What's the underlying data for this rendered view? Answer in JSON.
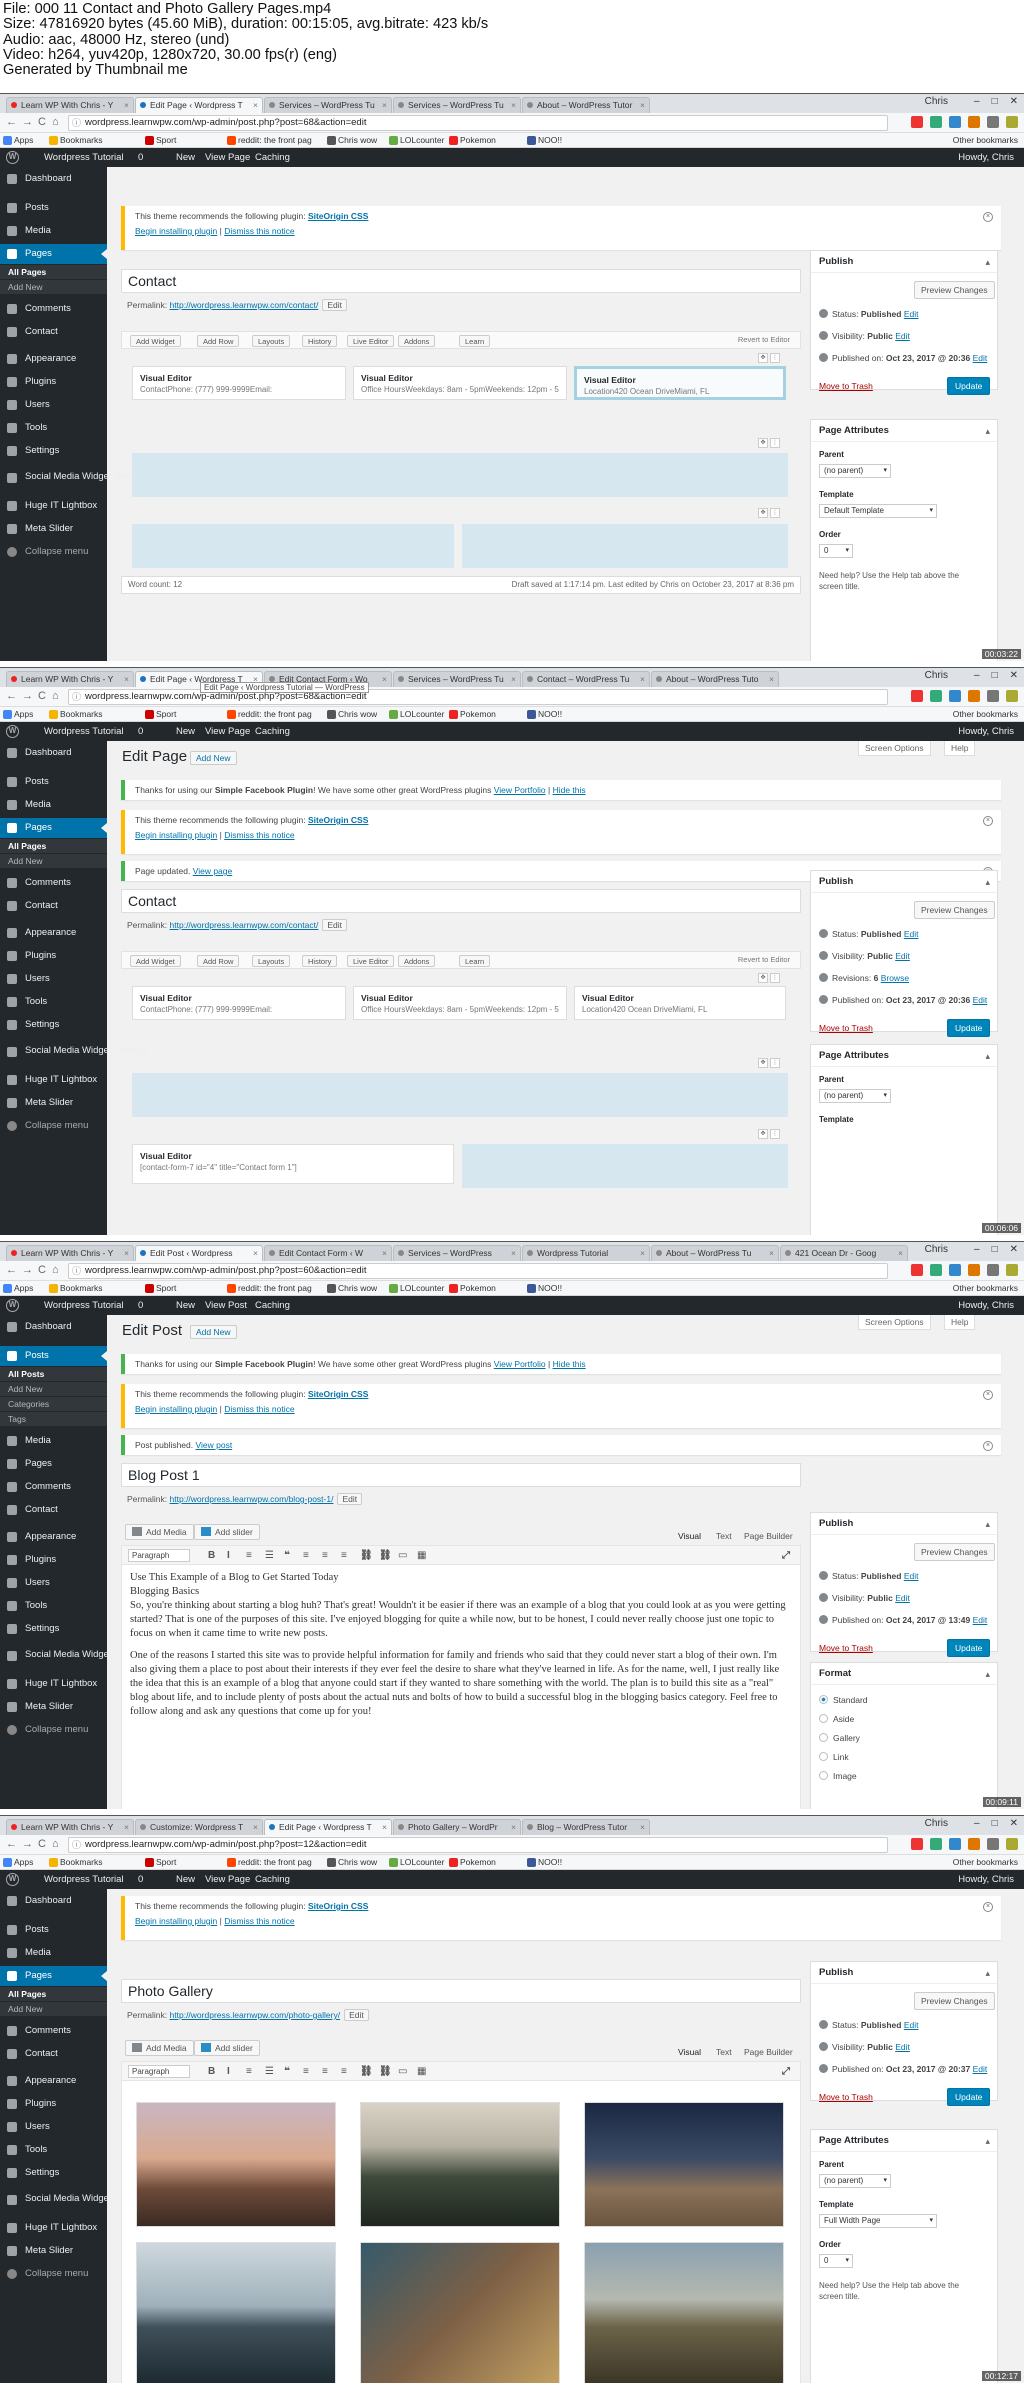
{
  "header": {
    "lines": [
      "File: 000 11 Contact and Photo Gallery Pages.mp4",
      "Size: 47816920 bytes (45.60 MiB), duration: 00:15:05, avg.bitrate: 423 kb/s",
      "Audio: aac, 48000 Hz, stereo (und)",
      "Video: h264, yuv420p, 1280x720, 30.00 fps(r) (eng)",
      "Generated by Thumbnail me"
    ]
  },
  "browser": {
    "user": "Chris",
    "back": "←",
    "forward": "→",
    "reload": "C",
    "home": "⌂",
    "bookmarks": [
      "Apps",
      "Bookmarks",
      "Sport",
      "reddit: the front pag",
      "Chris wow",
      "LOLcounter",
      "Pokemon",
      "NOO!!"
    ],
    "other_bookmarks": "Other bookmarks"
  },
  "admin_bar": {
    "site": "Wordpress Tutorial",
    "comments": "0",
    "new": "New",
    "view_page": "View Page",
    "view_post": "View Post",
    "caching": "Caching",
    "howdy": "Howdy, Chris"
  },
  "menu": {
    "dashboard": "Dashboard",
    "posts": "Posts",
    "media": "Media",
    "pages": "Pages",
    "all_pages": "All Pages",
    "add_new": "Add New",
    "all_posts": "All Posts",
    "categories": "Categories",
    "tags": "Tags",
    "comments": "Comments",
    "contact": "Contact",
    "appearance": "Appearance",
    "plugins": "Plugins",
    "users": "Users",
    "tools": "Tools",
    "settings": "Settings",
    "social_media": "Social Media Widget Settings",
    "huge_it": "Huge IT Lightbox",
    "meta_slider": "Meta Slider",
    "collapse": "Collapse menu"
  },
  "common": {
    "theme_notice": "This theme recommends the following plugin:",
    "plugin_name": "SiteOrigin CSS",
    "begin_install": "Begin installing plugin",
    "dismiss": "Dismiss this notice",
    "sep": "|",
    "fb_notice_pre": "Thanks for using our",
    "fb_notice_name": "Simple Facebook Plugin",
    "fb_notice_mid": "! We have some other great WordPress plugins",
    "view_portfolio": "View Portfolio",
    "hide_this": "Hide this",
    "permalink": "Permalink:",
    "edit": "Edit",
    "publish": "Publish",
    "preview_changes": "Preview Changes",
    "status_label": "Status:",
    "status_value": "Published",
    "visibility_label": "Visibility:",
    "visibility_value": "Public",
    "move_to_trash": "Move to Trash",
    "update": "Update",
    "page_attributes": "Page Attributes",
    "parent": "Parent",
    "no_parent": "(no parent)",
    "template": "Template",
    "order": "Order",
    "order_value": "0",
    "help_text": "Need help? Use the Help tab above the screen title.",
    "edit_page": "Edit Page",
    "edit_post": "Edit Post",
    "add_new": "Add New",
    "screen_options": "Screen Options",
    "help": "Help",
    "pb_buttons": [
      "Add Widget",
      "Add Row",
      "Layouts",
      "History",
      "Live Editor",
      "Addons",
      "Learn"
    ],
    "revert": "Revert to Editor",
    "visual_editor": "Visual Editor",
    "add_media": "Add Media",
    "add_slider": "Add slider",
    "tab_visual": "Visual",
    "tab_text": "Text",
    "tab_page_builder": "Page Builder",
    "paragraph": "Paragraph",
    "format": "Format"
  },
  "frames": [
    {
      "tabs": [
        "Learn WP With Chris - Y",
        "Edit Page ‹ Wordpress T",
        "Services – WordPress Tu",
        "Services – WordPress Tu",
        "About – WordPress Tutor"
      ],
      "active_tab": 1,
      "url": "wordpress.learnwpw.com/wp-admin/post.php?post=68&action=edit",
      "title": "Contact",
      "permalink_url": "http://wordpress.learnwpw.com/contact/",
      "widgets": [
        "ContactPhone: (777) 999-9999Email:",
        "Office HoursWeekdays: 8am - 5pmWeekends: 12pm - 5Pm",
        "Location420 Ocean DriveMiami, FL"
      ],
      "word_count": "Word count: 12",
      "draft_saved": "Draft saved at 1:17:14 pm. Last edited by Chris on October 23, 2017 at 8:36 pm",
      "published_on_label": "Published on:",
      "published_on": "Oct 23, 2017 @ 20:36",
      "template_value": "Default Template",
      "timestamp": "00:03:22"
    },
    {
      "tabs": [
        "Learn WP With Chris - Y",
        "Edit Page ‹ Wordpress T",
        "Edit Contact Form ‹ Wo",
        "Services – WordPress Tu",
        "Contact – WordPress Tu",
        "About – WordPress Tuto"
      ],
      "active_tab": 1,
      "tooltip": "Edit Page ‹ Wordpress Tutorial — WordPress",
      "url": "wordpress.learnwpw.com/wp-admin/post.php?post=68&action=edit",
      "page_updated": "Page updated.",
      "view_page": "View page",
      "title": "Contact",
      "permalink_url": "http://wordpress.learnwpw.com/contact/",
      "widgets": [
        "ContactPhone: (777) 999-9999Email:",
        "Office HoursWeekdays: 8am - 5pmWeekends: 12pm - 5Pm",
        "Location420 Ocean DriveMiami, FL"
      ],
      "widget4": "[contact-form-7 id=\"4\" title=\"Contact form 1\"]",
      "revisions_label": "Revisions:",
      "revisions_count": "6",
      "browse": "Browse",
      "published_on_label": "Published on:",
      "published_on": "Oct 23, 2017 @ 20:36",
      "timestamp": "00:06:06"
    },
    {
      "tabs": [
        "Learn WP With Chris - Y",
        "Edit Post ‹ Wordpress",
        "Edit Contact Form ‹ W",
        "Services – WordPress",
        "Wordpress Tutorial",
        "About – WordPress Tu",
        "421 Ocean Dr - Goog"
      ],
      "active_tab": 1,
      "url": "wordpress.learnwpw.com/wp-admin/post.php?post=60&action=edit",
      "post_published": "Post published.",
      "view_post": "View post",
      "title": "Blog Post 1",
      "permalink_url": "http://wordpress.learnwpw.com/blog-post-1/",
      "published_on_label": "Published on:",
      "published_on": "Oct 24, 2017 @ 13:49",
      "formats": [
        "Standard",
        "Aside",
        "Gallery",
        "Link",
        "Image"
      ],
      "content": [
        "Use This Example of a Blog to Get Started Today",
        "Blogging Basics",
        "So, you're thinking about starting a blog huh? That's great! Wouldn't it be easier if there was an example of a blog that you could look at as you were getting started? That is one of the purposes of this site. I've enjoyed blogging for quite a while now, but to be honest, I could never really choose just one topic to focus on when it came time to write new posts.",
        "One of the reasons I started this site was to provide helpful information for family and friends who said that they could never start a blog of their own. I'm also giving them a place to post about their interests if they ever feel the desire to share what they've learned in life. As for the name, well, I just really like the idea that this is an example of a blog that anyone could start if they wanted to share something with the world. The plan is to build this site as a \"real\" blog about life, and to include plenty of posts about the actual nuts and bolts of how to build a successful blog in the blogging basics category. Feel free to follow along and ask any questions that come up for you!"
      ],
      "timestamp": "00:09:11"
    },
    {
      "tabs": [
        "Learn WP With Chris - Y",
        "Customize: Wordpress T",
        "Edit Page ‹ Wordpress T",
        "Photo Gallery – WordPr",
        "Blog – WordPress Tutor"
      ],
      "active_tab": 2,
      "url": "wordpress.learnwpw.com/wp-admin/post.php?post=12&action=edit",
      "title": "Photo Gallery",
      "permalink_url": "http://wordpress.learnwpw.com/photo-gallery/",
      "published_on_label": "Published on:",
      "published_on": "Oct 23, 2017 @ 20:37",
      "template_value": "Full Width Page",
      "timestamp": "00:12:17"
    }
  ],
  "colors": {
    "wp_blue": "#0073aa",
    "admin_dark": "#23282d",
    "notice_yellow": "#ffb900",
    "notice_green": "#46b450"
  }
}
